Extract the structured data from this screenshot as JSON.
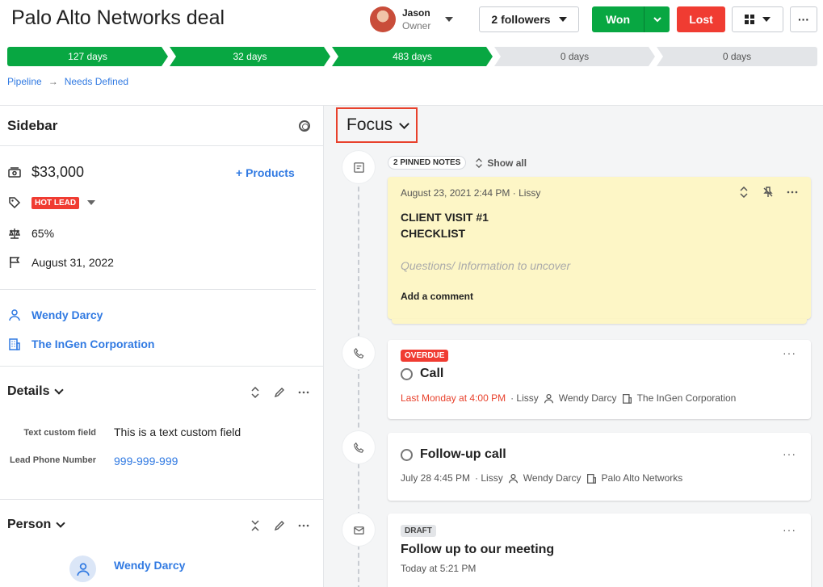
{
  "header": {
    "title": "Palo Alto Networks deal",
    "owner": {
      "name": "Jason",
      "role": "Owner"
    },
    "followers_label": "2 followers",
    "won_label": "Won",
    "lost_label": "Lost",
    "more_label": "···"
  },
  "stages": [
    "127 days",
    "32 days",
    "483 days",
    "0 days",
    "0 days"
  ],
  "breadcrumb": {
    "root": "Pipeline",
    "arrow": "→",
    "current": "Needs Defined"
  },
  "sidebar": {
    "title": "Sidebar",
    "value": "$33,000",
    "products_label": "+ Products",
    "label_tag": "HOT LEAD",
    "probability": "65%",
    "close_date": "August 31, 2022",
    "person_link": "Wendy Darcy",
    "org_link": "The InGen Corporation",
    "details": {
      "title": "Details",
      "fields": [
        {
          "label": "Text custom field",
          "value": "This is a text custom field"
        },
        {
          "label": "Lead Phone Number",
          "value": "999-999-999"
        }
      ]
    },
    "person_section": {
      "title": "Person",
      "name": "Wendy Darcy"
    }
  },
  "main": {
    "focus_label": "Focus",
    "pinned_label": "2 PINNED NOTES",
    "show_all_label": "Show all",
    "note": {
      "meta": "August 23, 2021 2:44 PM · Lissy",
      "line1": "CLIENT VISIT #1",
      "line2": "CHECKLIST",
      "faint": "Questions/ Information to uncover",
      "comment": "Add a comment"
    },
    "activities": [
      {
        "badge": "OVERDUE",
        "title": "Call",
        "time": "Last Monday at 4:00 PM",
        "user": "· Lissy",
        "person": "Wendy Darcy",
        "org": "The InGen Corporation"
      },
      {
        "title": "Follow-up call",
        "time": "July 28 4:45 PM",
        "user": "· Lissy",
        "person": "Wendy Darcy",
        "org": "Palo Alto Networks"
      },
      {
        "badge": "DRAFT",
        "title": "Follow up to our meeting",
        "time": "Today at 5:21 PM"
      }
    ]
  },
  "colors": {
    "green": "#08a742",
    "red": "#f03c32",
    "link": "#317ae2",
    "note_bg": "#fdf6c6"
  }
}
